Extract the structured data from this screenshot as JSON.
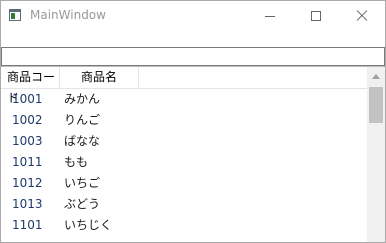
{
  "window": {
    "title": "MainWindow"
  },
  "search": {
    "value": ""
  },
  "grid": {
    "columns": [
      "商品コード",
      "商品名"
    ],
    "rows": [
      {
        "code": "1001",
        "name": "みかん"
      },
      {
        "code": "1002",
        "name": "りんご"
      },
      {
        "code": "1003",
        "name": "ばなな"
      },
      {
        "code": "1011",
        "name": "もも"
      },
      {
        "code": "1012",
        "name": "いちご"
      },
      {
        "code": "1013",
        "name": "ぶどう"
      },
      {
        "code": "1101",
        "name": "いちじく"
      }
    ]
  }
}
